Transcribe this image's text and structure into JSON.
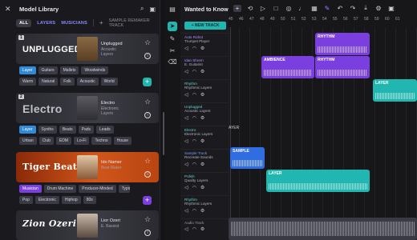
{
  "library": {
    "title": "Model Library",
    "tabs": [
      "ALL",
      "LAYERS",
      "MUSICIANS"
    ],
    "remaker_label": "SAMPLE REMAKER TRACK",
    "cards": [
      {
        "num": "1",
        "logo": "UNPLUGGED",
        "name": "Unplugged",
        "sub1": "Acoustic",
        "sub2": "Layers",
        "row1": [
          "Layer",
          "Guitars",
          "Mallets",
          "Woodwinds"
        ],
        "row2": [
          "Warm",
          "Natural",
          "Folk",
          "Acoustic",
          "World"
        ],
        "accent": "#21b7b0"
      },
      {
        "num": "2",
        "logo": "Electro",
        "name": "Electro",
        "sub1": "Electronic",
        "sub2": "Layers",
        "row1": [
          "Layer",
          "Synths",
          "Beats",
          "Pads",
          "Leads"
        ],
        "row2": [
          "Urban",
          "Club",
          "EDM",
          "Lo-Fi",
          "Techno",
          "House"
        ],
        "accent": "#21b7b0"
      },
      {
        "num": "",
        "logo": "Tiger Beats",
        "name": "Ido Namer",
        "sub1": "Beat Maker",
        "sub2": "",
        "row1": [
          "Musician",
          "Drum Machine",
          "Producer-Minded",
          "Typical"
        ],
        "row2": [
          "Pop",
          "Electronic",
          "Hiphop",
          "80s"
        ],
        "accent": "#7b3fe0"
      },
      {
        "num": "",
        "logo": "Zion Ozeri",
        "name": "Lior Ozeri",
        "sub1": "E. Bassist",
        "sub2": "",
        "row1": [],
        "row2": [],
        "accent": "#7b3fe0"
      }
    ]
  },
  "project": {
    "title": "Wanted to Know",
    "new_track": "NEW TRACK",
    "ruler": [
      "45",
      "46",
      "47",
      "48",
      "49",
      "50",
      "51",
      "52",
      "53",
      "54",
      "55",
      "56",
      "57",
      "58",
      "59",
      "60",
      "61"
    ],
    "tracks": [
      {
        "name": "Auto Robot",
        "sub": "Trumpet Player"
      },
      {
        "name": "Idan Shrem",
        "sub": "E. Guitarist"
      },
      {
        "name": "Rhythm",
        "sub": "Rhythmic Layers"
      },
      {
        "name": "Unplugged",
        "sub": "Acoustic Layers"
      },
      {
        "name": "Electro",
        "sub": "Electronic Layers"
      },
      {
        "name": "Sample Track",
        "sub": "Recreate Sounds"
      },
      {
        "name": "Polish",
        "sub": "Quality Layers"
      },
      {
        "name": "Rhythm",
        "sub": "Rhythmic Layers"
      },
      {
        "name": "Audio Track",
        "sub": ""
      }
    ],
    "clips": [
      {
        "label": "RHYTHM",
        "color": "#7b3fe0"
      },
      {
        "label": "AMBIENCE",
        "color": "#7b3fe0"
      },
      {
        "label": "RHYTHM",
        "color": "#7b3fe0"
      },
      {
        "label": "LAYER",
        "color": "#21b7b0"
      },
      {
        "label": "SAMPLE",
        "color": "#2f6de0"
      },
      {
        "label": "LAYER",
        "color": "#21b7b0"
      }
    ],
    "marker_label": "AYER"
  }
}
